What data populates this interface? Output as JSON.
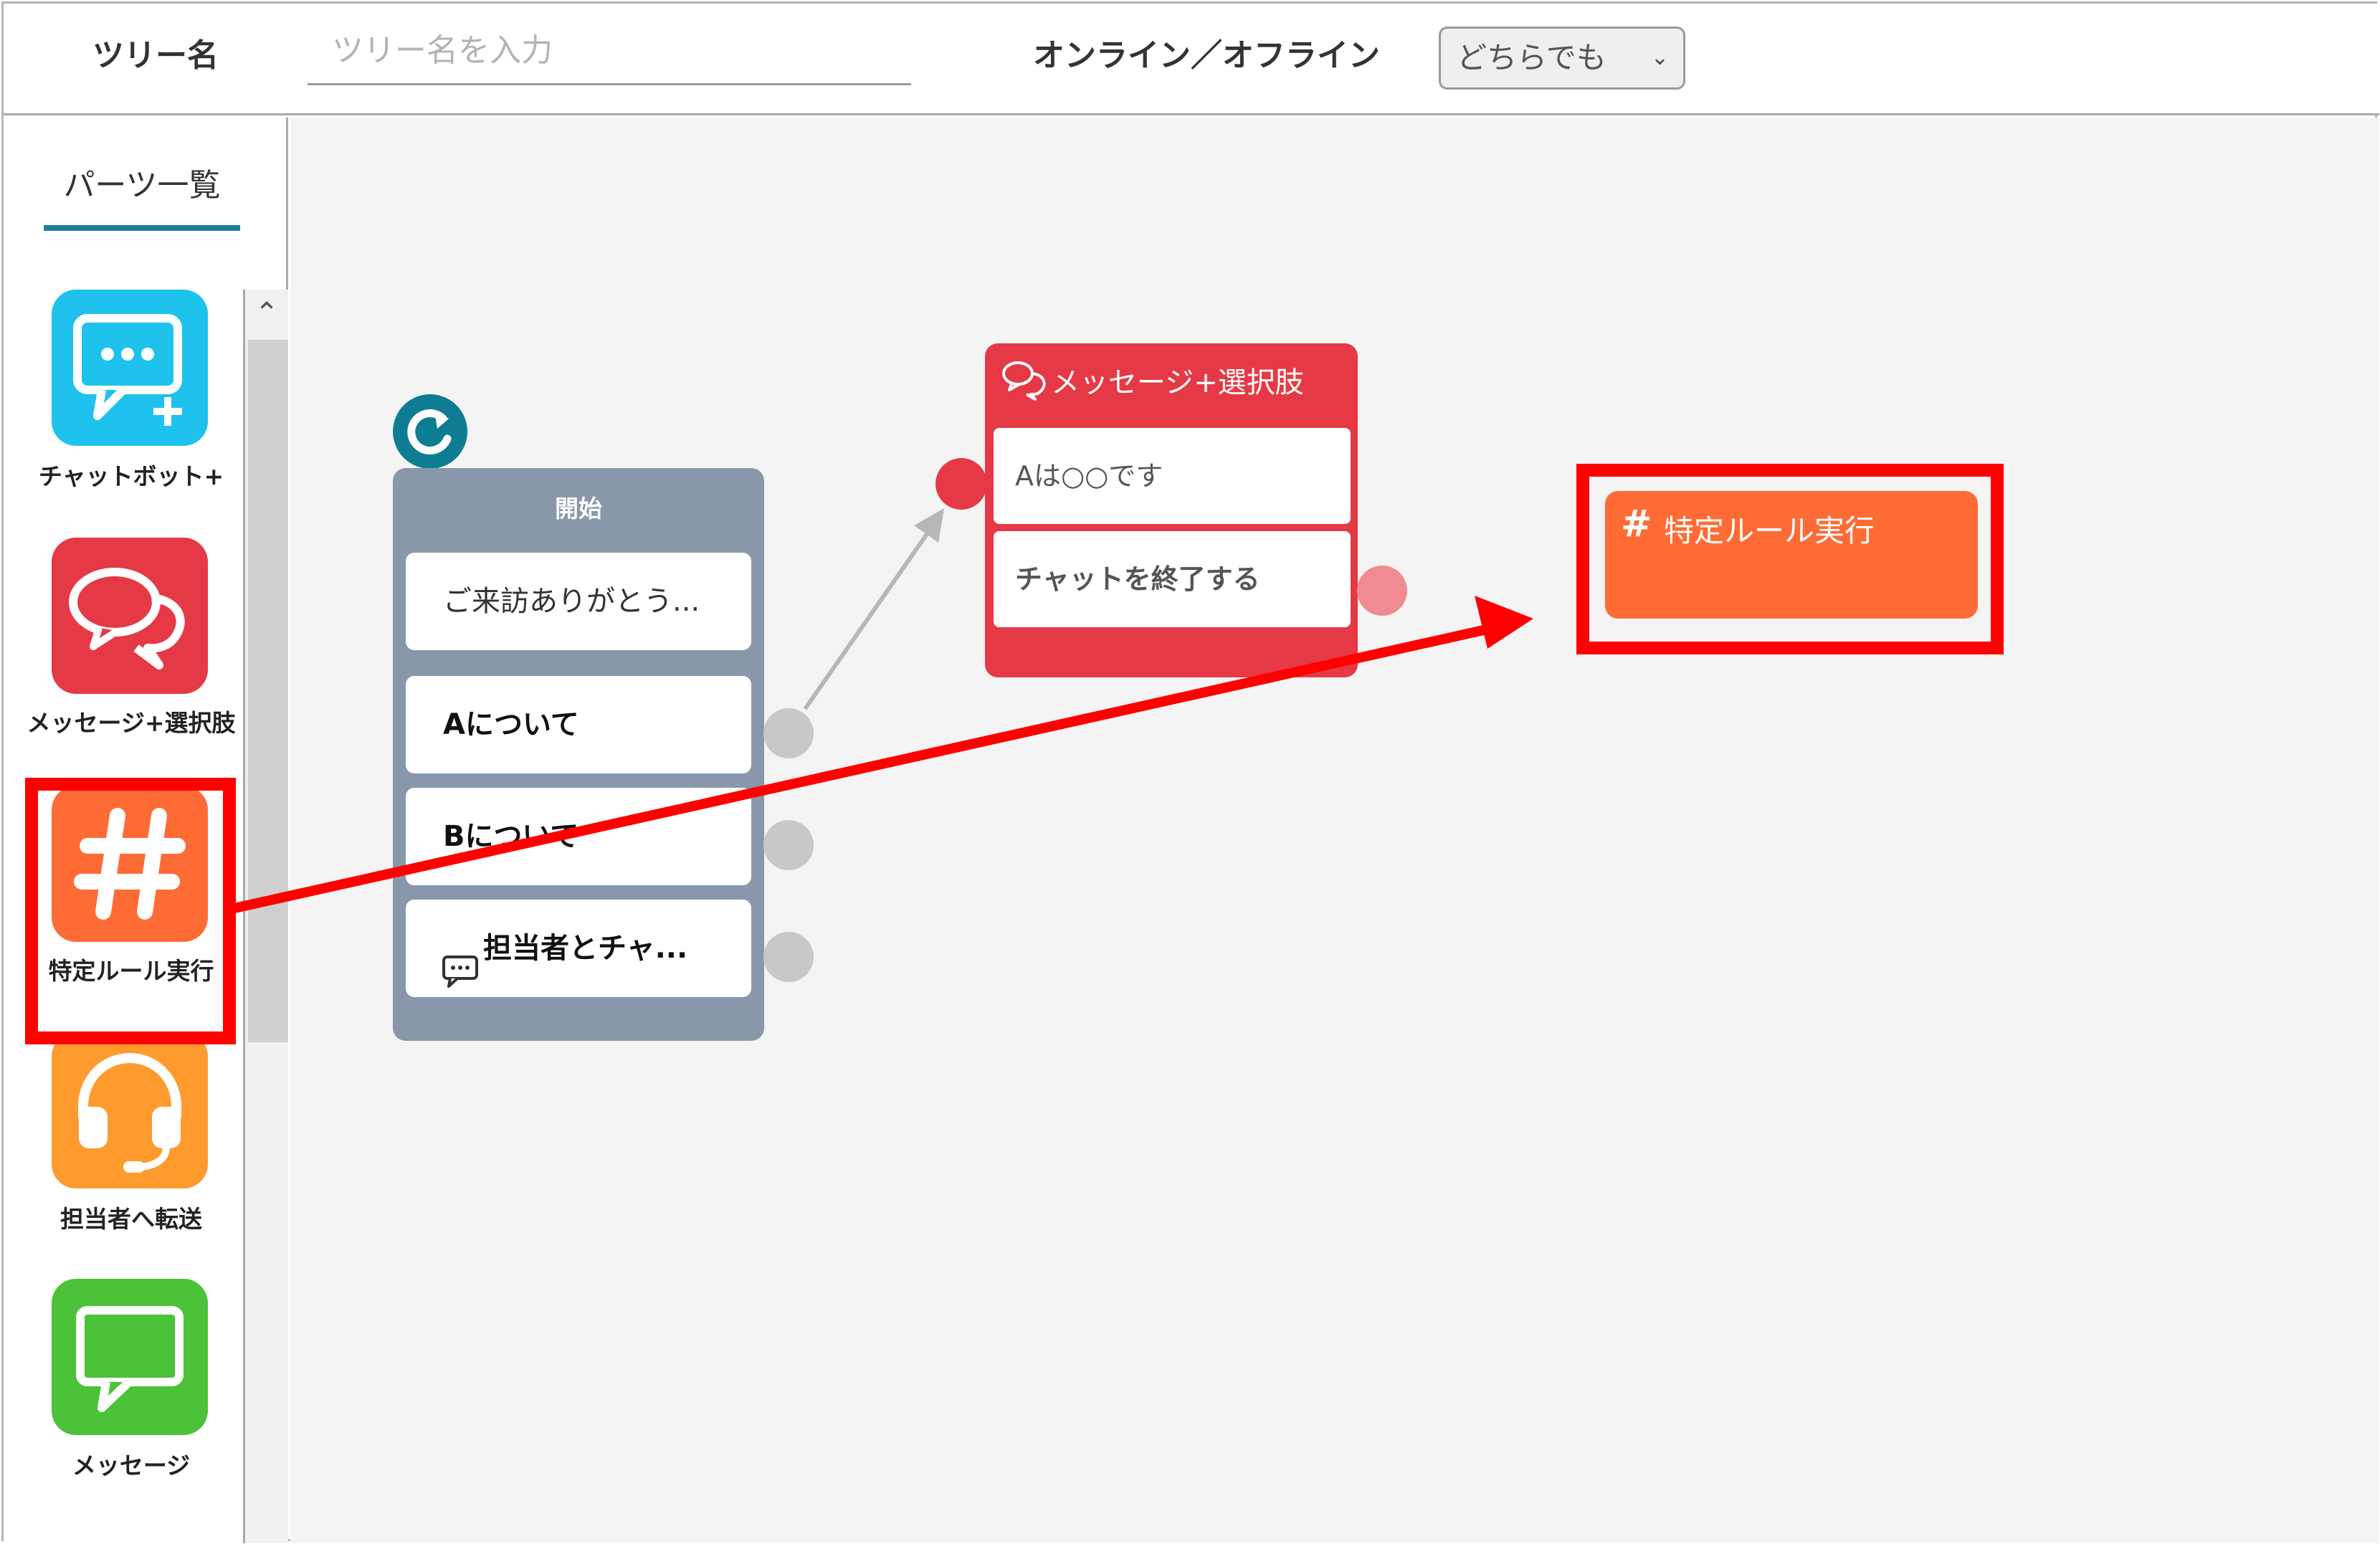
{
  "header": {
    "tree_label": "ツリー名",
    "tree_placeholder": "ツリー名を入力",
    "online_label": "オンライン／オフライン",
    "online_select_value": "どちらでも"
  },
  "sidebar": {
    "tab_label": "パーツ一覧",
    "parts": [
      {
        "label": "チャットボット+",
        "icon": "chatbot-plus-icon",
        "color": "#1fc2ec"
      },
      {
        "label": "メッセージ+選択肢",
        "icon": "message-choice-icon",
        "color": "#e63946"
      },
      {
        "label": "特定ルール実行",
        "icon": "hash-icon",
        "color": "#ff6b35"
      },
      {
        "label": "担当者へ転送",
        "icon": "headset-icon",
        "color": "#ff9a2e"
      },
      {
        "label": "メッセージ",
        "icon": "message-icon",
        "color": "#4cc238"
      }
    ]
  },
  "canvas": {
    "start_node": {
      "title": "開始",
      "options": [
        "ご来訪ありがとう...",
        "Aについて",
        "Bについて",
        "担当者とチャ..."
      ]
    },
    "message_node": {
      "title": "メッセージ+選択肢",
      "options": [
        "Aは○○です",
        "チャットを終了する"
      ]
    },
    "rule_node": {
      "title": "特定ルール実行"
    }
  },
  "colors": {
    "highlight": "#ff0000",
    "accent_teal": "#1b7f9c",
    "start_node": "#8898aa"
  }
}
